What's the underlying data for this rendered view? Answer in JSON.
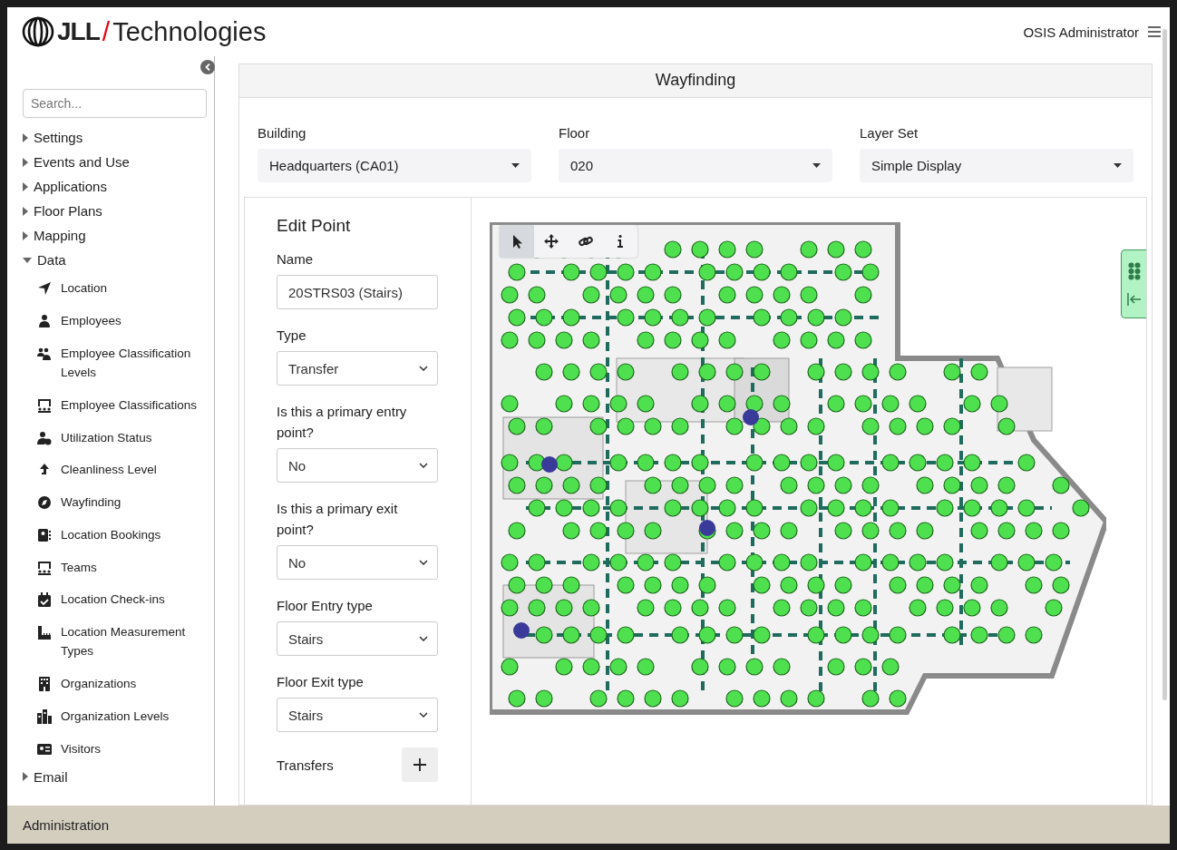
{
  "header": {
    "logo_brand": "JLL",
    "logo_separator": "/",
    "logo_product": "Technologies",
    "user": "OSIS Administrator"
  },
  "sidebar": {
    "search_placeholder": "Search...",
    "items": [
      {
        "label": "Settings",
        "expanded": false
      },
      {
        "label": "Events and Use",
        "expanded": false
      },
      {
        "label": "Applications",
        "expanded": false
      },
      {
        "label": "Floor Plans",
        "expanded": false
      },
      {
        "label": "Mapping",
        "expanded": false
      },
      {
        "label": "Data",
        "expanded": true,
        "children": [
          {
            "label": "Location"
          },
          {
            "label": "Employees"
          },
          {
            "label": "Employee Classification Levels"
          },
          {
            "label": "Employee Classifications"
          },
          {
            "label": "Utilization Status"
          },
          {
            "label": "Cleanliness Level"
          },
          {
            "label": "Wayfinding"
          },
          {
            "label": "Location Bookings"
          },
          {
            "label": "Teams"
          },
          {
            "label": "Location Check-ins"
          },
          {
            "label": "Location Measurement Types"
          },
          {
            "label": "Organizations"
          },
          {
            "label": "Organization Levels"
          },
          {
            "label": "Visitors"
          }
        ]
      },
      {
        "label": "Email",
        "expanded": false
      }
    ]
  },
  "page": {
    "title": "Wayfinding"
  },
  "filters": [
    {
      "label": "Building",
      "value": "Headquarters (CA01)"
    },
    {
      "label": "Floor",
      "value": "020"
    },
    {
      "label": "Layer Set",
      "value": "Simple Display"
    }
  ],
  "edit_point": {
    "title": "Edit Point",
    "fields": [
      {
        "label": "Name",
        "kind": "input",
        "value": "20STRS03 (Stairs)"
      },
      {
        "label": "Type",
        "kind": "select",
        "value": "Transfer"
      },
      {
        "label": "Is this a primary entry point?",
        "kind": "select",
        "value": "No"
      },
      {
        "label": "Is this a primary exit point?",
        "kind": "select",
        "value": "No"
      },
      {
        "label": "Floor Entry type",
        "kind": "select",
        "value": "Stairs"
      },
      {
        "label": "Floor Exit type",
        "kind": "select",
        "value": "Stairs"
      }
    ],
    "transfers_label": "Transfers"
  },
  "map": {
    "kind": "picture",
    "tools": [
      {
        "kind": "pointer",
        "selected": true
      },
      {
        "kind": "move",
        "selected": false
      },
      {
        "kind": "link",
        "selected": false
      },
      {
        "kind": "info",
        "selected": false
      }
    ]
  },
  "footer": "Administration"
}
